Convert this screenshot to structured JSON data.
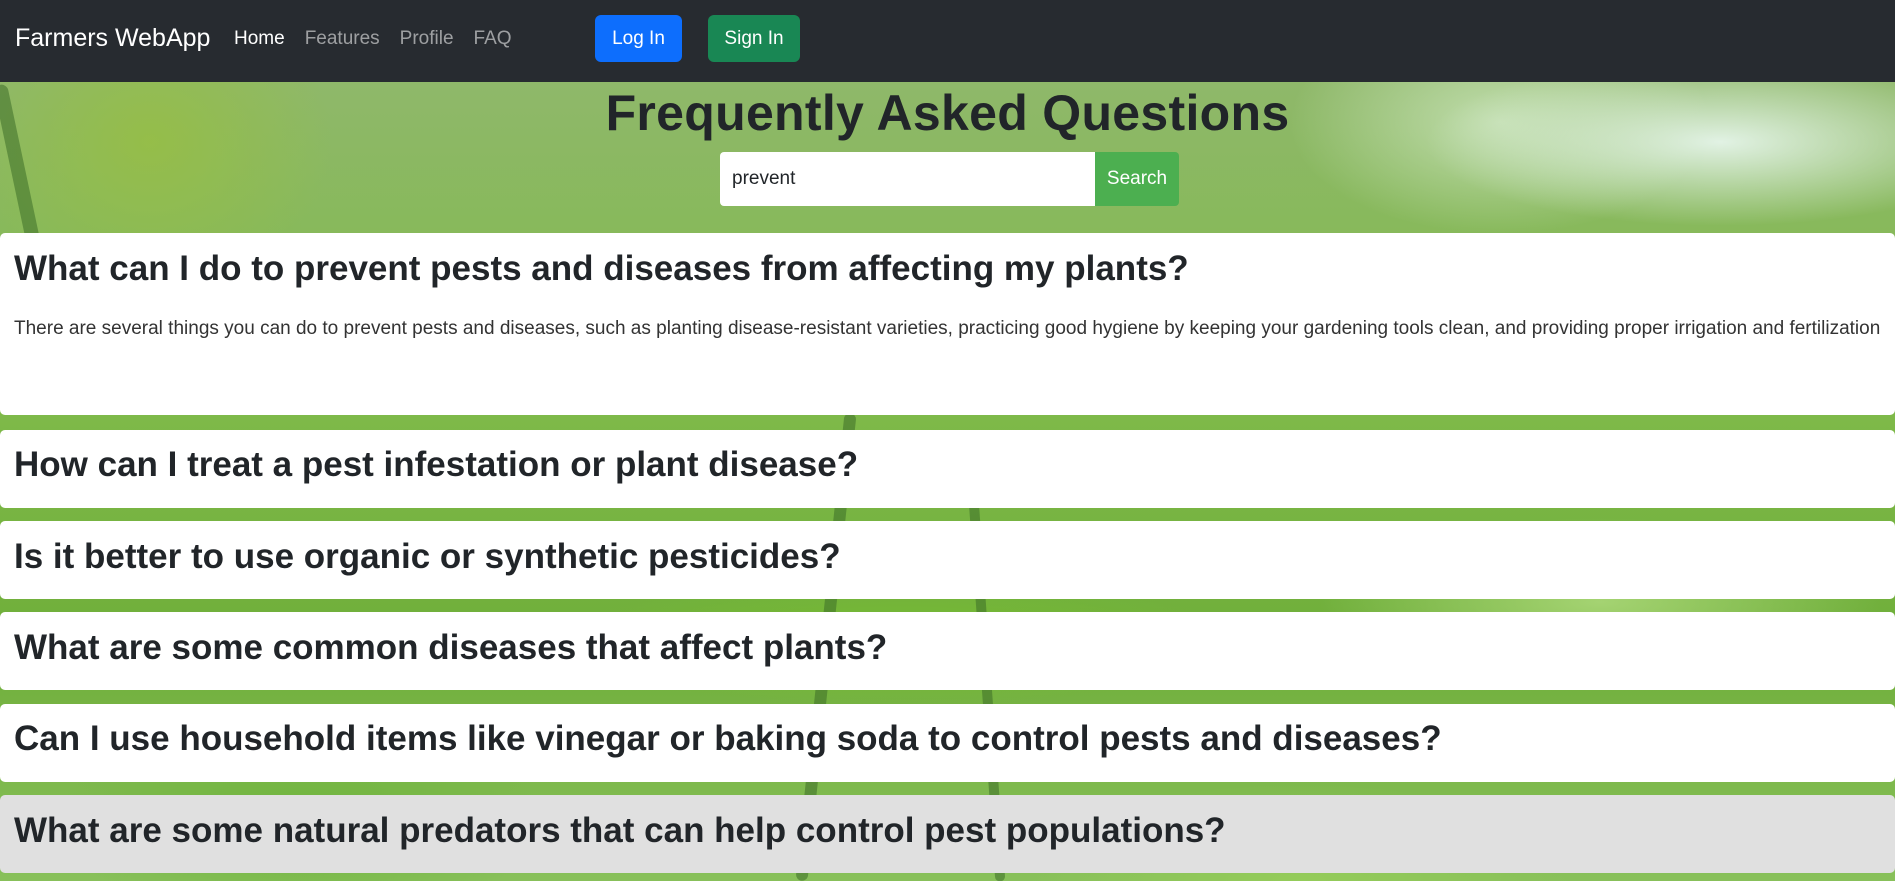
{
  "navbar": {
    "brand": "Farmers WebApp",
    "links": [
      {
        "label": "Home",
        "active": true
      },
      {
        "label": "Features",
        "active": false
      },
      {
        "label": "Profile",
        "active": false
      },
      {
        "label": "FAQ",
        "active": false
      }
    ],
    "login_label": "Log In",
    "signin_label": "Sign In"
  },
  "page": {
    "title": "Frequently Asked Questions"
  },
  "search": {
    "value": "prevent",
    "button_label": "Search"
  },
  "faqs": [
    {
      "question": "What can I do to prevent pests and diseases from affecting my plants?",
      "answer": "There are several things you can do to prevent pests and diseases, such as planting disease-resistant varieties, practicing good hygiene by keeping your gardening tools clean, and providing proper irrigation and fertilization",
      "expanded": true
    },
    {
      "question": "How can I treat a pest infestation or plant disease?",
      "expanded": false
    },
    {
      "question": "Is it better to use organic or synthetic pesticides?",
      "expanded": false
    },
    {
      "question": "What are some common diseases that affect plants?",
      "expanded": false
    },
    {
      "question": "Can I use household items like vinegar or baking soda to control pests and diseases?",
      "expanded": false
    },
    {
      "question": "What are some natural predators that can help control pest populations?",
      "expanded": false,
      "hovered": true
    }
  ],
  "colors": {
    "navbar_bg": "#272b30",
    "login_button": "#0d6efd",
    "signin_button": "#198754",
    "search_button": "#4caf50",
    "hover_item_bg": "#e0e0e0"
  }
}
